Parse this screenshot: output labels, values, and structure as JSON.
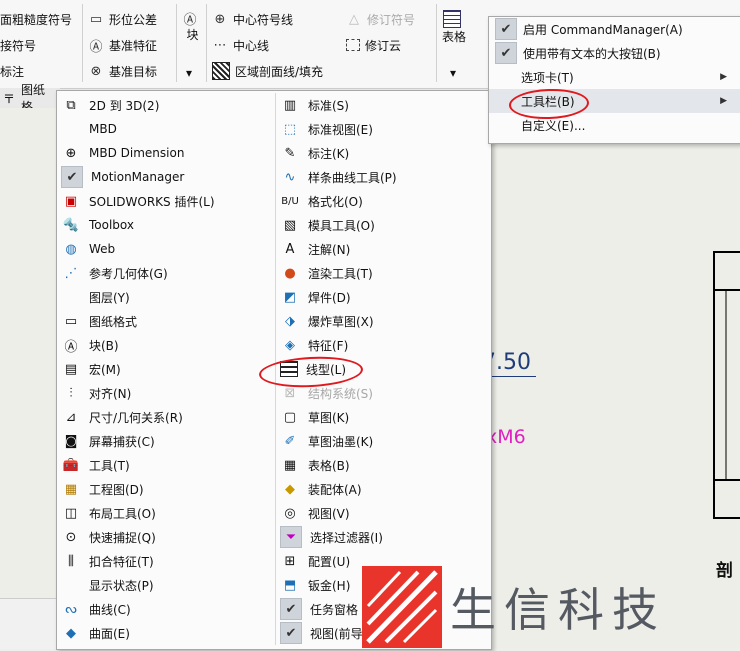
{
  "ribbon": {
    "col1": [
      "面粗糙度符号",
      "接符号",
      "标注"
    ],
    "col2": [
      "形位公差",
      "基准特征",
      "基准目标"
    ],
    "block_label": "块",
    "col3": [
      "中心符号线",
      "中心线",
      "区域剖面线/填充"
    ],
    "revision_symbol": "修订符号",
    "revision_cloud": "修订云",
    "table_label": "表格"
  },
  "tab_label": "图纸格",
  "menu_col1": [
    "2D 到 3D(2)",
    "MBD",
    "MBD Dimension",
    "MotionManager",
    "SOLIDWORKS 插件(L)",
    "Toolbox",
    "Web",
    "参考几何体(G)",
    "图层(Y)",
    "图纸格式",
    "块(B)",
    "宏(M)",
    "对齐(N)",
    "尺寸/几何关系(R)",
    "屏幕捕获(C)",
    "工具(T)",
    "工程图(D)",
    "布局工具(O)",
    "快速捕捉(Q)",
    "扣合特征(T)",
    "显示状态(P)",
    "曲线(C)",
    "曲面(E)"
  ],
  "menu_col2": [
    "标准(S)",
    "标准视图(E)",
    "标注(K)",
    "样条曲线工具(P)",
    "格式化(O)",
    "模具工具(O)",
    "注解(N)",
    "渲染工具(T)",
    "焊件(D)",
    "爆炸草图(X)",
    "特征(F)",
    "线型(L)",
    "结构系统(S)",
    "草图(K)",
    "草图油墨(K)",
    "表格(B)",
    "装配体(A)",
    "视图(V)",
    "选择过滤器(I)",
    "配置(U)",
    "钣金(H)",
    "任务窗格",
    "视图(前导)(H)"
  ],
  "submenu": [
    "启用 CommandManager(A)",
    "使用带有文本的大按钮(B)",
    "选项卡(T)",
    "工具栏(B)",
    "自定义(E)..."
  ],
  "drawing": {
    "dim1": "7.50",
    "dim2": "xM6",
    "section": "剖"
  },
  "logo_text": "生信科技",
  "colors": {
    "highlight_ring": "#e0191e",
    "dim_blue": "#1f3c7a",
    "dim_magenta": "#e020c0"
  }
}
